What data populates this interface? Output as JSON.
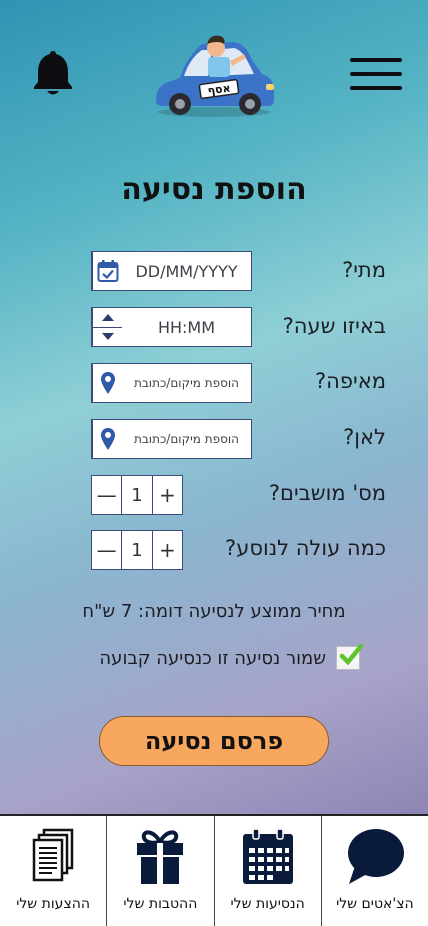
{
  "header": {
    "logo_text": "אסף",
    "bell_icon": "bell-icon",
    "menu_icon": "hamburger-menu-icon"
  },
  "title": "הוספת נסיעה",
  "form": {
    "when": {
      "label": "מתי?",
      "placeholder": "DD/MM/YYYY",
      "icon": "calendar-check-icon"
    },
    "time": {
      "label": "באיזו שעה?",
      "placeholder": "HH:MM"
    },
    "from": {
      "label": "מאיפה?",
      "placeholder": "הוספת מיקום/כתובת",
      "icon": "location-pin-icon"
    },
    "to": {
      "label": "לאן?",
      "placeholder": "הוספת מיקום/כתובת",
      "icon": "location-pin-icon"
    },
    "seats": {
      "label": "מס' מושבים?",
      "value": "1",
      "minus": "—",
      "plus": "+"
    },
    "price": {
      "label": "כמה עולה לנוסע?",
      "value": "1",
      "minus": "—",
      "plus": "+"
    }
  },
  "avg_price_text": "מחיר ממוצע לנסיעה דומה: 7 ש\"ח",
  "save_regular": {
    "label": "שמור נסיעה זו כנסיעה קבועה",
    "checked": true
  },
  "publish_label": "פרסם נסיעה",
  "tabs": [
    {
      "label": "הצ'אטים שלי",
      "icon": "chat-bubble-icon"
    },
    {
      "label": "הנסיעות שלי",
      "icon": "calendar-icon"
    },
    {
      "label": "ההטבות שלי",
      "icon": "gift-icon"
    },
    {
      "label": "ההצעות שלי",
      "icon": "documents-icon"
    }
  ],
  "colors": {
    "accent_button": "#f8a75e",
    "field_border": "#3c4c7a",
    "icon_blue": "#2e5aa8",
    "check_green": "#5fc22e"
  }
}
